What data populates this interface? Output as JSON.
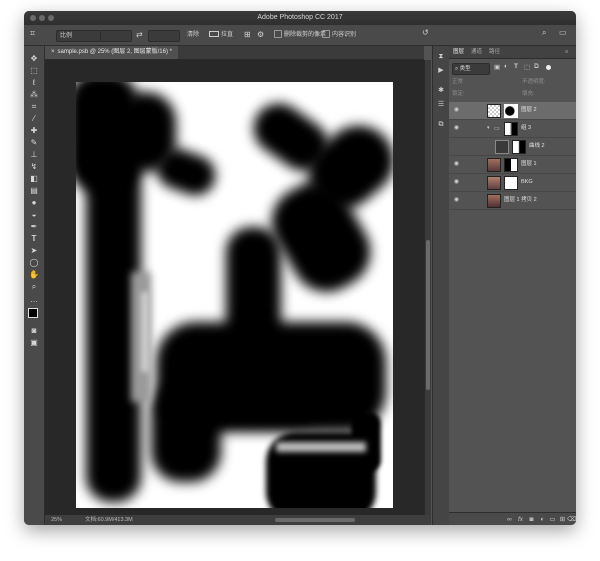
{
  "window": {
    "title": "Adobe Photoshop CC 2017"
  },
  "options_bar": {
    "tool_icon": "crop-icon",
    "ratio_label": "比例",
    "clear_label": "清除",
    "straighten_label": "拉直",
    "delete_cropped_label": "删除裁剪的像素",
    "content_aware_label": "内容识别"
  },
  "document_tab": {
    "label": "sample.psb @ 25% (图层 2, 图层蒙版/16) *"
  },
  "status_bar": {
    "zoom": "25%",
    "doc_info": "文档:60.9M/413.3M"
  },
  "panel": {
    "tabs": [
      "图层",
      "通道",
      "路径"
    ],
    "filter_kind": "类型",
    "mode_label": "正常",
    "opacity_label": "不透明度:",
    "lock_label": "锁定:",
    "fill_label": "填充:"
  },
  "layers": [
    {
      "name": "图层 2",
      "selected": true,
      "eye": true,
      "indent": 0
    },
    {
      "name": "组 3",
      "selected": false,
      "eye": true,
      "indent": 1
    },
    {
      "name": "曲线 2",
      "selected": false,
      "eye": false,
      "indent": 2
    },
    {
      "name": "图层 1",
      "selected": false,
      "eye": true,
      "indent": 0
    },
    {
      "name": "BKG",
      "selected": false,
      "eye": true,
      "indent": 0
    },
    {
      "name": "图层 1 拷贝 2",
      "selected": false,
      "eye": true,
      "indent": 0
    }
  ],
  "colors": {
    "workspace": "#535353",
    "canvas_bg": "#282828",
    "selected_layer": "#6c6c6c"
  }
}
